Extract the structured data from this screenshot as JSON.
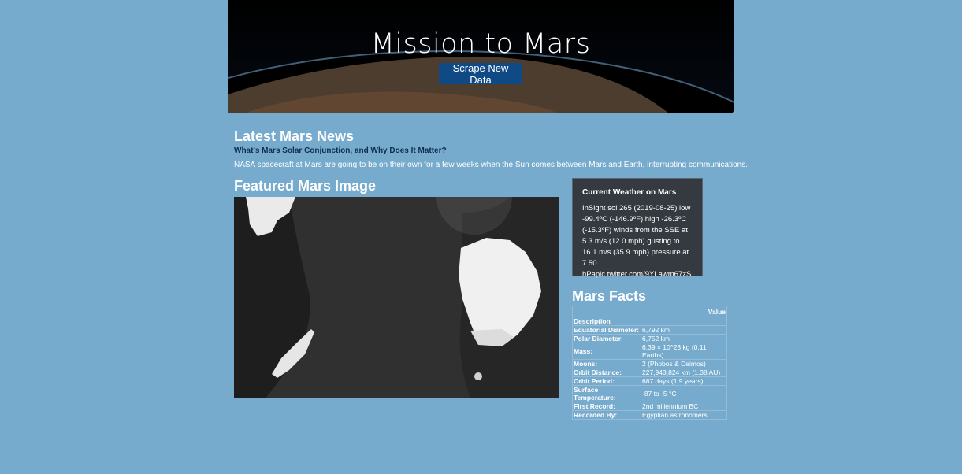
{
  "jumbotron": {
    "title": "Mission to Mars",
    "button_label": "Scrape New Data"
  },
  "news": {
    "heading": "Latest Mars News",
    "title": "What's Mars Solar Conjunction, and Why Does It Matter?",
    "body": "NASA spacecraft at Mars are going to be on their own for a few weeks when the Sun comes between Mars and Earth, interrupting communications."
  },
  "featured": {
    "heading": "Featured Mars Image"
  },
  "weather": {
    "title": "Current Weather on Mars",
    "text": "InSight sol 265 (2019-08-25) low -99.4ºC (-146.9ºF) high -26.3ºC (-15.3ºF) winds from the SSE at 5.3 m/s (12.0 mph) gusting to 16.1 m/s (35.9 mph) pressure at 7.50 hPapic.twitter.com/9YLawm67zS"
  },
  "facts": {
    "heading": "Mars Facts",
    "column_header": "Value",
    "rows": [
      {
        "label": "Description",
        "value": ""
      },
      {
        "label": "Equatorial Diameter:",
        "value": "6,792 km"
      },
      {
        "label": "Polar Diameter:",
        "value": "6,752 km"
      },
      {
        "label": "Mass:",
        "value": "6.39 × 10^23 kg (0.11 Earths)"
      },
      {
        "label": "Moons:",
        "value": "2 (Phobos & Deimos)"
      },
      {
        "label": "Orbit Distance:",
        "value": "227,943,824 km (1.38 AU)"
      },
      {
        "label": "Orbit Period:",
        "value": "687 days (1.9 years)"
      },
      {
        "label": "Surface Temperature:",
        "value": "-87 to -5 °C"
      },
      {
        "label": "First Record:",
        "value": "2nd millennium BC"
      },
      {
        "label": "Recorded By:",
        "value": "Egyptian astronomers"
      }
    ]
  },
  "colors": {
    "page_background": "#77abcd",
    "button": "#0f4a85",
    "weather_panel": "#343a40",
    "news_title": "#0e2f4f"
  }
}
